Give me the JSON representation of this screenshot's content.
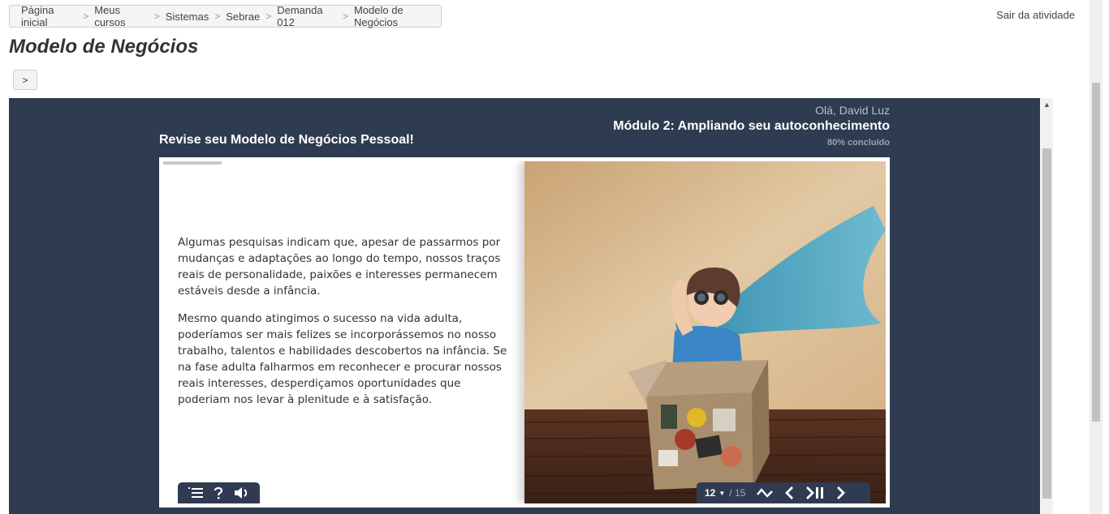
{
  "breadcrumb": {
    "items": [
      "Página inicial",
      "Meus cursos",
      "Sistemas",
      "Sebrae",
      "Demanda 012",
      "Modelo de Negócios"
    ],
    "separator": ">"
  },
  "header": {
    "exit_label": "Sair da atividade",
    "page_title": "Modelo de Negócios",
    "next_label": ">"
  },
  "module": {
    "greeting": "Olá, David Luz",
    "module_title": "Módulo 2: Ampliando seu autoconhecimento",
    "progress_label": "80% concluído",
    "progress_value": 0.8,
    "lesson_title": "Revise seu Modelo de Negócios Pessoal!",
    "paragraphs": [
      "Algumas pesquisas indicam que, apesar de passarmos por mudanças e adaptações ao longo do tempo, nossos traços reais de personalidade, paixões e interesses permanecem estáveis desde a infância.",
      "Mesmo quando atingimos o sucesso na vida adulta, poderíamos ser mais felizes se incorporássemos no nosso trabalho, talentos e habilidades descobertos na infância. Se na fase adulta falharmos em reconhecer e procurar nossos reais interesses, desperdiçamos oportunidades que poderiam nos levar à plenitude e à satisfação."
    ],
    "nav": {
      "current_page": "12",
      "total_pages": "/ 15"
    },
    "colors": {
      "panel": "#2e3b50",
      "text_muted": "#9aa3b0"
    }
  }
}
